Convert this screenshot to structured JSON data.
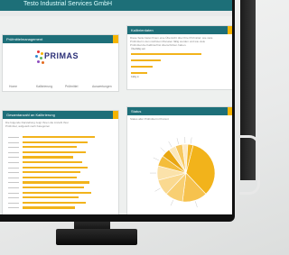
{
  "app": {
    "title": "Testo Industrial Services GmbH"
  },
  "panels": {
    "project_management": {
      "title": "Prüfmittelmanagement"
    },
    "calibration": {
      "title": "Kalibrierdaten",
      "desc_line1": "Diese Seite bietet Ihnen eine Übersicht über Ihre Prüfmittel: wie viele",
      "desc_line2": "Prüfmittel in den nächsten Monaten fällig werden und wie viele",
      "desc_line3": "Prüfmittel die Kalibrierfrist überschritten haben.",
      "legend_top": "Überfällig seit",
      "legend_bottom": "Fällig in"
    },
    "inventory": {
      "title": "Gesamtanzahl an Kalibrierung",
      "desc_line1": "Die folgende Darstellung zeigt Ihnen die Anzahl Ihrer",
      "desc_line2": "Prüfmittel, aufgeteilt nach Kategorien",
      "desc_line3": ""
    },
    "status": {
      "title": "Status",
      "desc_line1": "Status aller Prüfmittel in Prozent",
      "desc_line2": "",
      "desc_line3": ""
    }
  },
  "logo": {
    "name": "PRIMAS"
  },
  "links": [
    "Home",
    "Kalibrierung",
    "Prüfmittel",
    "Auswertungen"
  ],
  "colors": {
    "header": "#1e6f79",
    "accent": "#f5b400",
    "bar": "#f2b31b"
  },
  "chart_data": [
    {
      "type": "bar",
      "orientation": "horizontal",
      "panel": "calibration",
      "values": [
        52,
        22,
        16,
        12
      ],
      "xlim": [
        0,
        60
      ]
    },
    {
      "type": "bar",
      "orientation": "horizontal",
      "panel": "inventory",
      "values": [
        40,
        36,
        30,
        35,
        28,
        33,
        36,
        32,
        30,
        37,
        34,
        38,
        31,
        35,
        29
      ],
      "xlim": [
        0,
        50
      ]
    },
    {
      "type": "pie",
      "panel": "status",
      "values": [
        34,
        14,
        10,
        9,
        8,
        6,
        5,
        4,
        4,
        3,
        3
      ],
      "colors": [
        "#f2b31b",
        "#f6c24e",
        "#f8cf72",
        "#fad990",
        "#fbe2aa",
        "#f4bd3a",
        "#e9a711",
        "#fbe8bc",
        "#f7c85f",
        "#fde9c2",
        "#f3b72b"
      ]
    }
  ]
}
